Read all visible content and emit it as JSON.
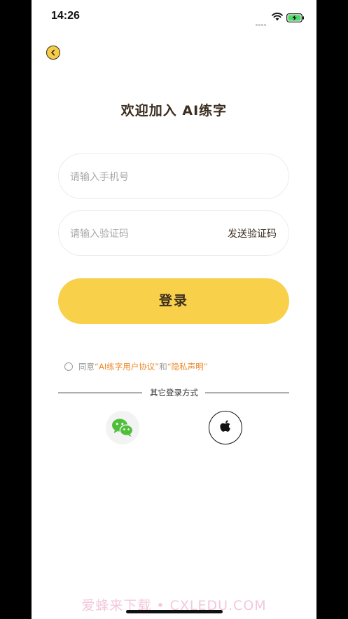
{
  "status_bar": {
    "time": "14:26"
  },
  "page": {
    "title": "欢迎加入 AI练字"
  },
  "phone_field": {
    "placeholder": "请输入手机号"
  },
  "code_field": {
    "placeholder": "请输入验证码",
    "send_code_label": "发送验证码"
  },
  "login_button": {
    "label": "登录"
  },
  "agreement": {
    "prefix": "同意",
    "user_agreement": "“AI练字用户协议”",
    "conjunction": "和",
    "privacy": "“隐私声明”"
  },
  "other_login": {
    "label": "其它登录方式",
    "methods": [
      {
        "name": "wechat",
        "icon": "wechat-icon"
      },
      {
        "name": "apple",
        "icon": "apple-icon"
      }
    ]
  },
  "watermark": "爱蜂来下载 • CXLEDU.COM",
  "colors": {
    "accent": "#f8d04a",
    "title_text": "#3c2e20",
    "link": "#ee8a2c",
    "wechat_green": "#4fbf3a"
  }
}
